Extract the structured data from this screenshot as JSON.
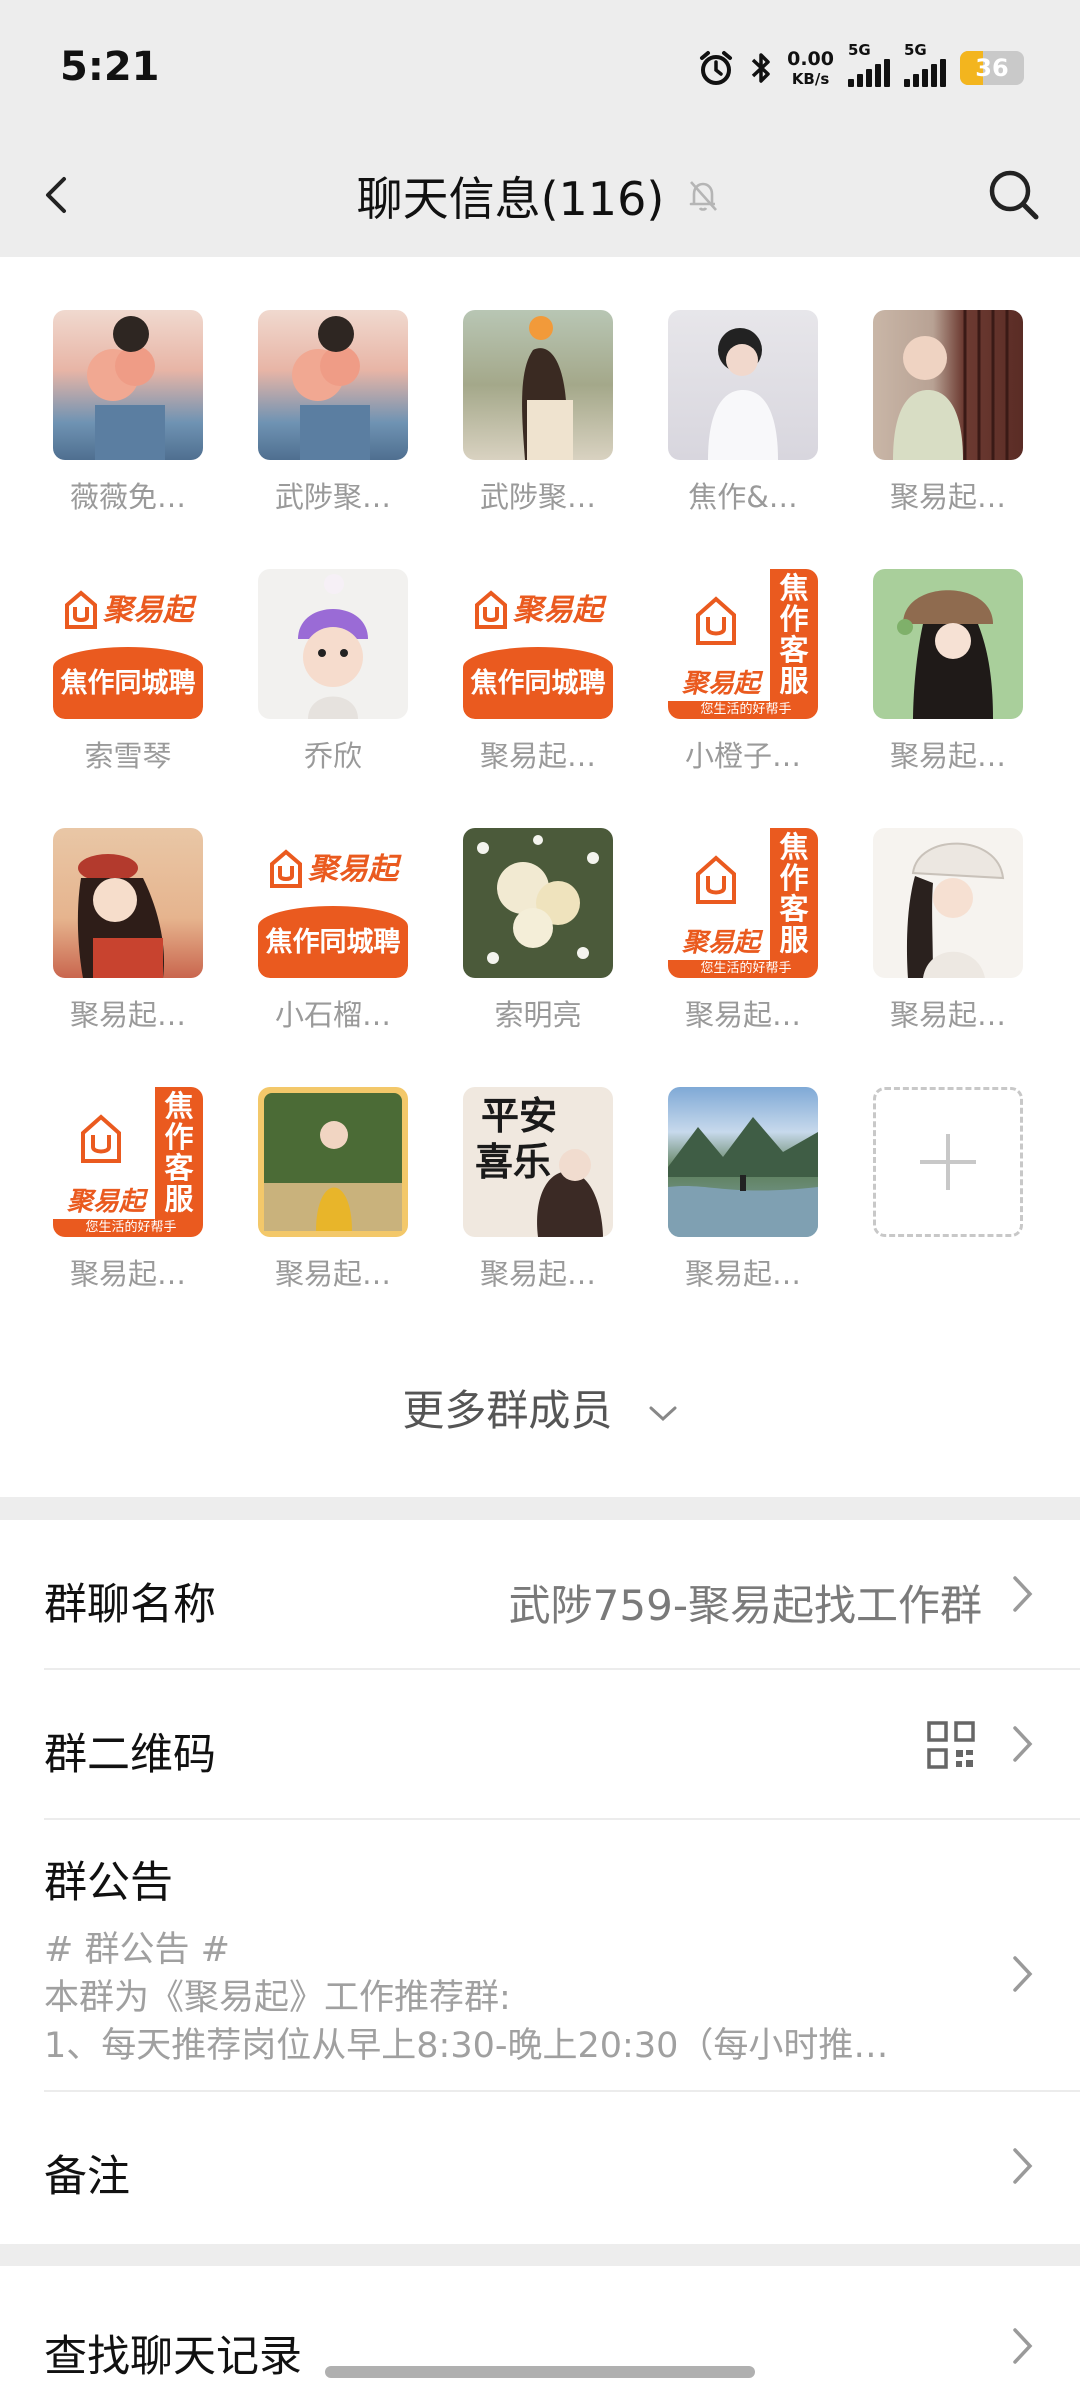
{
  "status_bar": {
    "time": "5:21",
    "net_speed_value": "0.00",
    "net_speed_unit": "KB/s",
    "sim1": "5G",
    "sim2": "5G",
    "battery": "36"
  },
  "header": {
    "title": "聊天信息(116)",
    "back_icon": "chevron-left-icon",
    "mute_icon": "bell-off-icon",
    "search_icon": "search-icon"
  },
  "members": [
    {
      "name": "薇薇免…"
    },
    {
      "name": "武陟聚…"
    },
    {
      "name": "武陟聚…"
    },
    {
      "name": "焦作&…"
    },
    {
      "name": "聚易起…"
    },
    {
      "name": "索雪琴"
    },
    {
      "name": "乔欣"
    },
    {
      "name": "聚易起…"
    },
    {
      "name": "小橙子…"
    },
    {
      "name": "聚易起…"
    },
    {
      "name": "聚易起…"
    },
    {
      "name": "小石榴…"
    },
    {
      "name": "索明亮"
    },
    {
      "name": "聚易起…"
    },
    {
      "name": "聚易起…"
    },
    {
      "name": "聚易起…"
    },
    {
      "name": "聚易起…"
    },
    {
      "name": "聚易起…"
    },
    {
      "name": "聚易起…"
    }
  ],
  "brand": {
    "logo_text": "聚易起",
    "band_text": "焦作同城聘",
    "side_text": "焦作客服",
    "foot_text": "您生活的好帮手"
  },
  "more_members": "更多群成员",
  "settings": {
    "group_name_label": "群聊名称",
    "group_name_value": "武陟759-聚易起找工作群",
    "qr_label": "群二维码",
    "announcement_label": "群公告",
    "announcement_lines": [
      "# 群公告 #",
      "本群为《聚易起》工作推荐群:",
      "1、每天推荐岗位从早上8:30-晚上20:30（每小时推…"
    ],
    "remark_label": "备注",
    "search_history_label": "查找聊天记录"
  },
  "colors": {
    "brand_orange": "#ea5a1f",
    "background": "#ededed"
  }
}
